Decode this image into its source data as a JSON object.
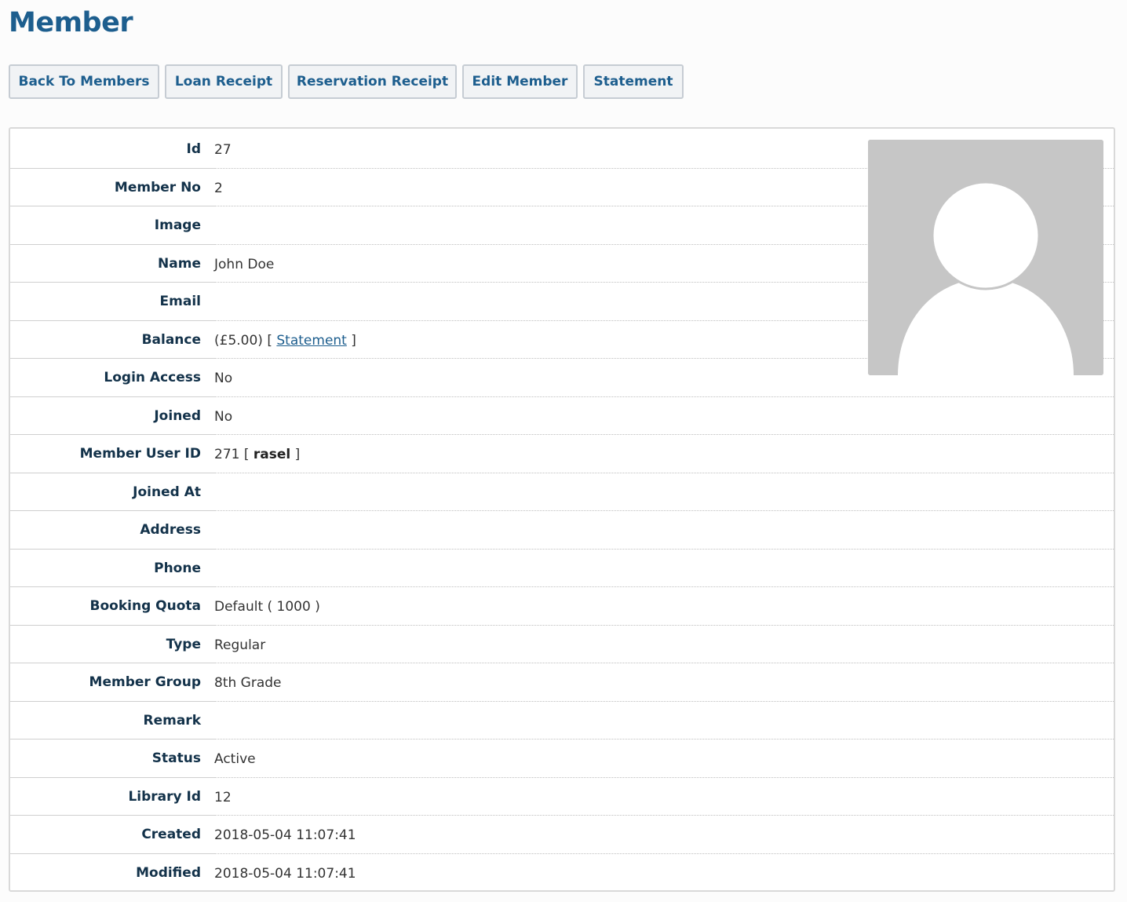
{
  "page": {
    "title": "Member"
  },
  "toolbar": {
    "back_label": "Back To Members",
    "loan_label": "Loan Receipt",
    "reservation_label": "Reservation Receipt",
    "edit_label": "Edit Member",
    "statement_label": "Statement"
  },
  "member": {
    "id": {
      "label": "Id",
      "value": "27"
    },
    "member_no": {
      "label": "Member No",
      "value": "2"
    },
    "image": {
      "label": "Image",
      "value": ""
    },
    "name": {
      "label": "Name",
      "value": "John Doe"
    },
    "email": {
      "label": "Email",
      "value": ""
    },
    "balance": {
      "label": "Balance",
      "amount": "(£5.00)",
      "bracket_open": "[",
      "link": "Statement",
      "bracket_close": "]"
    },
    "login_access": {
      "label": "Login Access",
      "value": "No"
    },
    "joined": {
      "label": "Joined",
      "value": "No"
    },
    "member_user_id": {
      "label": "Member User ID",
      "value": "271",
      "bracket_open": "[",
      "username": "rasel",
      "bracket_close": "]"
    },
    "joined_at": {
      "label": "Joined At",
      "value": ""
    },
    "address": {
      "label": "Address",
      "value": ""
    },
    "phone": {
      "label": "Phone",
      "value": ""
    },
    "booking_quota": {
      "label": "Booking Quota",
      "value": "Default ( 1000 )"
    },
    "type": {
      "label": "Type",
      "value": "Regular"
    },
    "member_group": {
      "label": "Member Group",
      "value": "8th Grade"
    },
    "remark": {
      "label": "Remark",
      "value": ""
    },
    "status": {
      "label": "Status",
      "value": "Active"
    },
    "library_id": {
      "label": "Library Id",
      "value": "12"
    },
    "created": {
      "label": "Created",
      "value": "2018-05-04 11:07:41"
    },
    "modified": {
      "label": "Modified",
      "value": "2018-05-04 11:07:41"
    }
  },
  "avatar": {
    "icon": "default-user-avatar-icon",
    "background": "#c6c6c6",
    "silhouette": "#ffffff"
  },
  "colors": {
    "accent": "#1d5e8e",
    "label": "#13324a"
  }
}
